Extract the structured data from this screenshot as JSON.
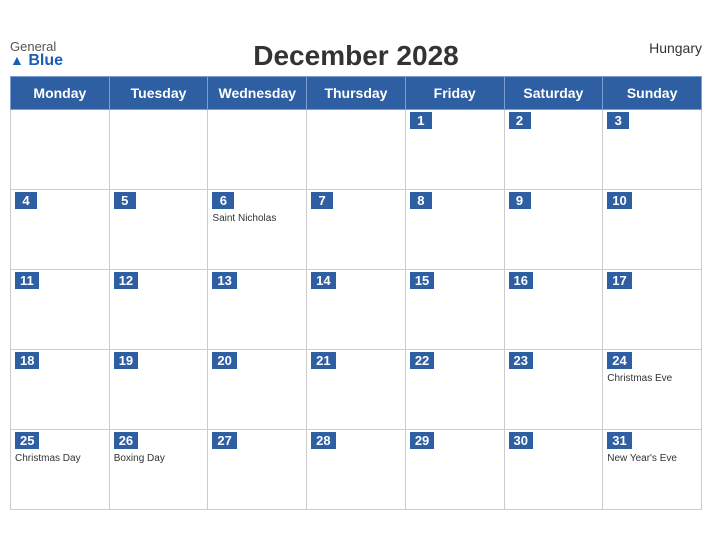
{
  "brand": {
    "general": "General",
    "blue": "Blue",
    "icon": "▲"
  },
  "title": "December 2028",
  "country": "Hungary",
  "days_of_week": [
    "Monday",
    "Tuesday",
    "Wednesday",
    "Thursday",
    "Friday",
    "Saturday",
    "Sunday"
  ],
  "weeks": [
    [
      {
        "day": null,
        "holiday": null
      },
      {
        "day": null,
        "holiday": null
      },
      {
        "day": null,
        "holiday": null
      },
      {
        "day": null,
        "holiday": null
      },
      {
        "day": "1",
        "holiday": null
      },
      {
        "day": "2",
        "holiday": null
      },
      {
        "day": "3",
        "holiday": null
      }
    ],
    [
      {
        "day": "4",
        "holiday": null
      },
      {
        "day": "5",
        "holiday": null
      },
      {
        "day": "6",
        "holiday": "Saint Nicholas"
      },
      {
        "day": "7",
        "holiday": null
      },
      {
        "day": "8",
        "holiday": null
      },
      {
        "day": "9",
        "holiday": null
      },
      {
        "day": "10",
        "holiday": null
      }
    ],
    [
      {
        "day": "11",
        "holiday": null
      },
      {
        "day": "12",
        "holiday": null
      },
      {
        "day": "13",
        "holiday": null
      },
      {
        "day": "14",
        "holiday": null
      },
      {
        "day": "15",
        "holiday": null
      },
      {
        "day": "16",
        "holiday": null
      },
      {
        "day": "17",
        "holiday": null
      }
    ],
    [
      {
        "day": "18",
        "holiday": null
      },
      {
        "day": "19",
        "holiday": null
      },
      {
        "day": "20",
        "holiday": null
      },
      {
        "day": "21",
        "holiday": null
      },
      {
        "day": "22",
        "holiday": null
      },
      {
        "day": "23",
        "holiday": null
      },
      {
        "day": "24",
        "holiday": "Christmas Eve"
      }
    ],
    [
      {
        "day": "25",
        "holiday": "Christmas Day"
      },
      {
        "day": "26",
        "holiday": "Boxing Day"
      },
      {
        "day": "27",
        "holiday": null
      },
      {
        "day": "28",
        "holiday": null
      },
      {
        "day": "29",
        "holiday": null
      },
      {
        "day": "30",
        "holiday": null
      },
      {
        "day": "31",
        "holiday": "New Year's Eve"
      }
    ]
  ]
}
